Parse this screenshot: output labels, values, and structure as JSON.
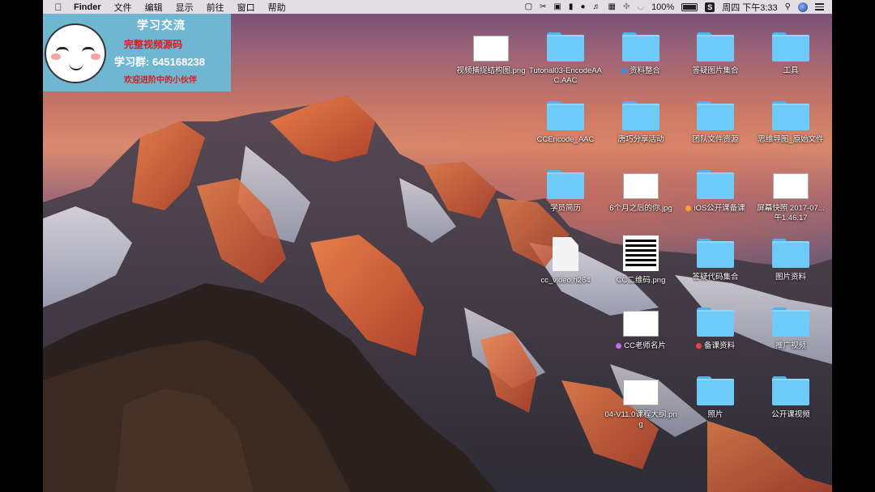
{
  "menubar": {
    "app_name": "Finder",
    "menus": [
      "文件",
      "编辑",
      "显示",
      "前往",
      "窗口",
      "帮助"
    ],
    "battery": "100%",
    "datetime": "周四 下午3:33"
  },
  "banner": {
    "title": "学习交流",
    "line1": "完整视频源码",
    "line2": "学习群: 645168238",
    "line3": "欢迎进阶中的小伙伴"
  },
  "desktop_items": [
    {
      "label": "视频捕捉结构图.png",
      "kind": "image"
    },
    {
      "label": "Tutorial03-EncodeAAC.AAC",
      "kind": "folder"
    },
    {
      "label": "资料整合",
      "kind": "folder",
      "tag_color": "#3a8ee6"
    },
    {
      "label": "答疑图片集合",
      "kind": "folder"
    },
    {
      "label": "工具",
      "kind": "folder"
    },
    {
      "label": "CCEncode_AAC",
      "kind": "folder"
    },
    {
      "label": "唐巧分享活动",
      "kind": "folder"
    },
    {
      "label": "团队文件资源",
      "kind": "folder"
    },
    {
      "label": "思维导图_原始文件",
      "kind": "folder"
    },
    {
      "label": "学员简历",
      "kind": "folder"
    },
    {
      "label": "6个月之后的你.jpg",
      "kind": "image"
    },
    {
      "label": "iOS公开课备课",
      "kind": "folder",
      "tag_color": "#f5a623"
    },
    {
      "label": "屏幕快照 2017-07...午1.46.17",
      "kind": "image"
    },
    {
      "label": "cc_video.h264",
      "kind": "document"
    },
    {
      "label": "CC二维码.png",
      "kind": "qr"
    },
    {
      "label": "答疑代码集合",
      "kind": "folder"
    },
    {
      "label": "图片资料",
      "kind": "folder"
    },
    {
      "label": "CC老师名片",
      "kind": "image",
      "tag_color": "#c36ce8"
    },
    {
      "label": "备课资料",
      "kind": "folder",
      "tag_color": "#e94040"
    },
    {
      "label": "推广视频",
      "kind": "folder"
    },
    {
      "label": "04-V11.0课程大纲.png",
      "kind": "image"
    },
    {
      "label": "照片",
      "kind": "folder"
    },
    {
      "label": "公开课视频",
      "kind": "folder"
    }
  ]
}
